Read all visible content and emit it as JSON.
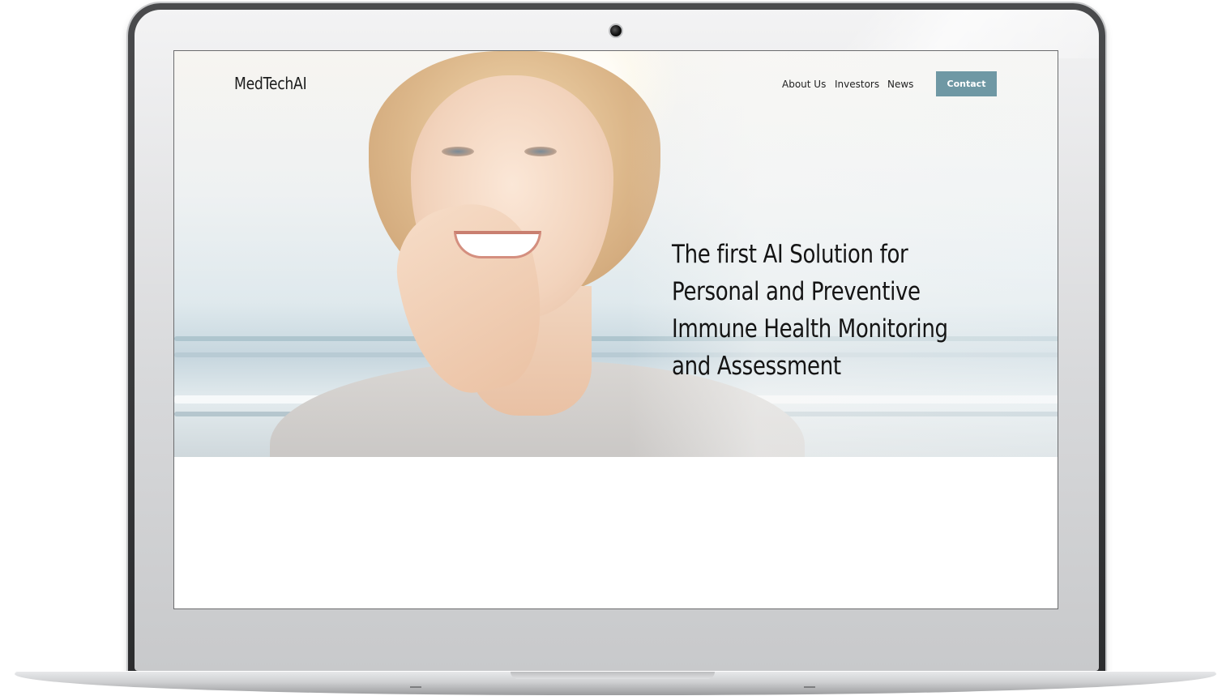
{
  "site": {
    "logo": "MedTechAI",
    "nav": {
      "items": [
        {
          "label": "About Us"
        },
        {
          "label": "Investors"
        },
        {
          "label": "News"
        }
      ],
      "cta_label": "Contact"
    },
    "hero": {
      "headline_lines": [
        "The first AI Solution for",
        "Personal and Preventive",
        "Immune Health Monitoring",
        "and Assessment"
      ],
      "image": "smiling-woman-beach-photo"
    }
  },
  "colors": {
    "accent": "#6f98a4",
    "text": "#141414",
    "background": "#ffffff",
    "device_frame": "#d8d9db"
  },
  "icons": {
    "camera": "webcam-icon"
  }
}
